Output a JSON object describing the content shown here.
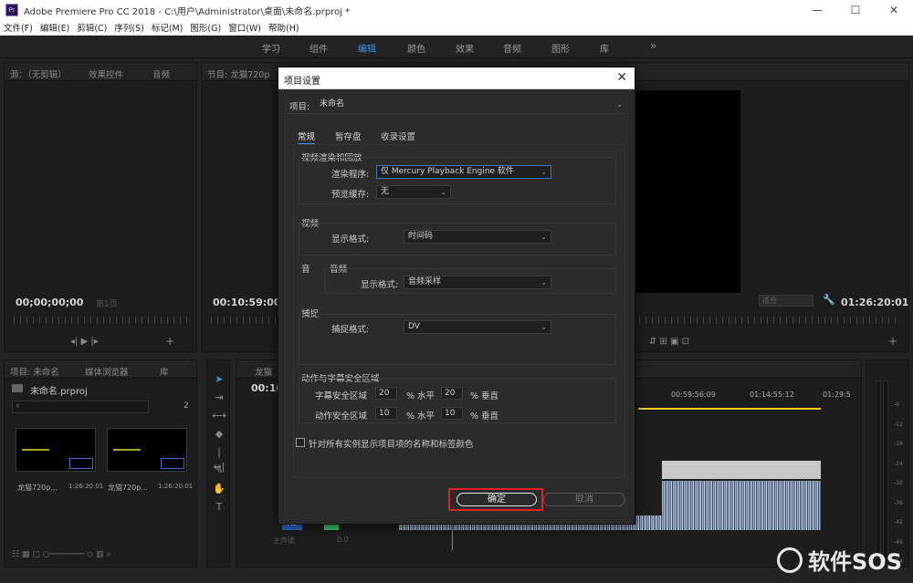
{
  "window": {
    "title": "Adobe Premiere Pro CC 2018 - C:\\用户\\Administrator\\桌面\\未命名.prproj *",
    "app_icon": "Pr",
    "controls": [
      "—",
      "☐",
      "✕"
    ]
  },
  "menu": [
    "文件(F)",
    "编辑(E)",
    "剪辑(C)",
    "序列(S)",
    "标记(M)",
    "图形(G)",
    "窗口(W)",
    "帮助(H)"
  ],
  "workspaces": {
    "items": [
      "学习",
      "组件",
      "编辑",
      "颜色",
      "效果",
      "音频",
      "图形",
      "库"
    ],
    "active": "编辑",
    "more": "»"
  },
  "source_panel": {
    "tabs": [
      "源：（无剪辑）",
      "效果控件",
      "音频"
    ],
    "timecode": "00;00;00;00",
    "page": "第1页"
  },
  "program_panel": {
    "tab": "节目: 龙猫720p",
    "timecode_left": "00:10:59:00",
    "timecode_right": "01:26:20:01",
    "fit": "适合"
  },
  "project_panel": {
    "tabs": [
      "项目: 未命名",
      "媒体浏览器",
      "库"
    ],
    "project_file": "未命名.prproj",
    "count": "2",
    "items": [
      {
        "name": "龙猫720p...",
        "duration": "1:26:20:01"
      },
      {
        "name": "龙猫720p...",
        "duration": "1:26:20:01"
      }
    ]
  },
  "timeline": {
    "tab": "龙猫",
    "timecode": "00:10",
    "ruler": [
      "00:59:56:09",
      "01:14:55:12",
      "01:29:5"
    ],
    "track_label": "A3",
    "master": "主声道",
    "master_value": "0.0"
  },
  "audio_meter": {
    "scale": [
      "-6",
      "-12",
      "-18",
      "-24",
      "-30",
      "-36",
      "-42",
      "-48",
      "-54"
    ]
  },
  "dialog": {
    "title": "项目设置",
    "close": "✕",
    "project_label": "项目:",
    "project_name": "未命名",
    "tabs": [
      "常规",
      "暂存盘",
      "收录设置"
    ],
    "active_tab": "常规",
    "video_render": {
      "section": "视频渲染和回放",
      "renderer_label": "渲染程序:",
      "renderer_value": "仅 Mercury Playback Engine 软件",
      "preview_cache_label": "预览缓存:",
      "preview_cache_value": "无"
    },
    "video": {
      "section": "视频",
      "format_label": "显示格式:",
      "format_value": "时间码",
      "partial_label": "音"
    },
    "audio": {
      "section": "音频",
      "format_label": "显示格式:",
      "format_value": "音频采样"
    },
    "capture": {
      "section": "捕捉",
      "format_label": "捕捉格式:",
      "format_value": "DV"
    },
    "safe_areas": {
      "section": "动作与字幕安全区域",
      "title_label": "字幕安全区域",
      "title_h": "20",
      "title_v": "20",
      "action_label": "动作安全区域",
      "action_h": "10",
      "action_v": "10",
      "pct_h": "% 水平",
      "pct_v": "% 垂直"
    },
    "checkbox_label": "针对所有实例显示项目项的名称和标签颜色",
    "ok": "确定",
    "cancel": "取消"
  },
  "watermark": "软件SOS",
  "colors": {
    "accent": "#3c95e8",
    "highlight": "#e02020",
    "bg": "#232323"
  }
}
